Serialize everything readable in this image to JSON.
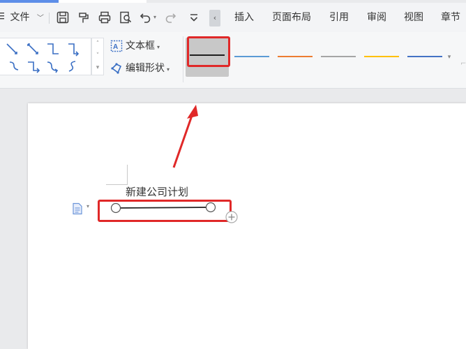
{
  "menubar": {
    "file_label": "文件",
    "tabs": [
      "插入",
      "页面布局",
      "引用",
      "审阅",
      "视图",
      "章节"
    ]
  },
  "ribbon": {
    "textbox_label": "文本框",
    "edit_shape_label": "编辑形状",
    "line_styles": [
      {
        "color": "#1f1f1f",
        "selected": true
      },
      {
        "color": "#5b9bd5",
        "selected": false
      },
      {
        "color": "#ed7d31",
        "selected": false
      },
      {
        "color": "#a5a5a5",
        "selected": false
      },
      {
        "color": "#ffc000",
        "selected": false
      },
      {
        "color": "#4472c4",
        "selected": false
      }
    ]
  },
  "document": {
    "title_text": "新建公司计划"
  },
  "colors": {
    "highlight": "#e02828",
    "accent_blue": "#5d8ee8"
  }
}
